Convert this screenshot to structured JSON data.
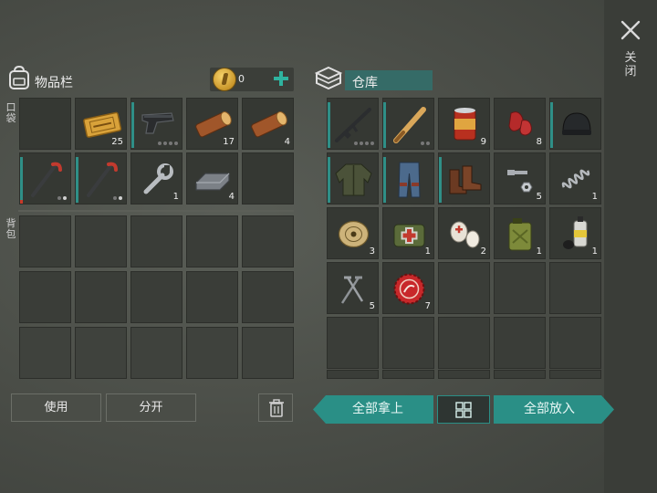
{
  "close": {
    "label": "关闭"
  },
  "inventory": {
    "title": "物品栏",
    "coins": "0",
    "pocket_label": "口袋",
    "backpack_label": "背包",
    "pocket_slots": [
      {
        "item": "",
        "qty": ""
      },
      {
        "item": "coupon",
        "qty": "25"
      },
      {
        "item": "pistol",
        "qty": ""
      },
      {
        "item": "log",
        "qty": "17"
      },
      {
        "item": "log",
        "qty": "4"
      },
      {
        "item": "crowbar",
        "qty": ""
      },
      {
        "item": "crowbar",
        "qty": ""
      },
      {
        "item": "wrench",
        "qty": "1"
      },
      {
        "item": "steel-bar",
        "qty": "4"
      },
      {
        "item": "",
        "qty": ""
      }
    ],
    "buttons": {
      "use": "使用",
      "split": "分开"
    }
  },
  "storage": {
    "title": "仓库",
    "slots": [
      {
        "item": "rifle",
        "qty": ""
      },
      {
        "item": "baseball-bat",
        "qty": ""
      },
      {
        "item": "canned-food",
        "qty": "9"
      },
      {
        "item": "raw-meat",
        "qty": "8"
      },
      {
        "item": "beanie",
        "qty": ""
      },
      {
        "item": "jacket",
        "qty": ""
      },
      {
        "item": "jeans",
        "qty": ""
      },
      {
        "item": "boots",
        "qty": ""
      },
      {
        "item": "nuts-bolts",
        "qty": "5"
      },
      {
        "item": "spring",
        "qty": "1"
      },
      {
        "item": "rope-spool",
        "qty": "3"
      },
      {
        "item": "first-aid-bag",
        "qty": "1"
      },
      {
        "item": "bandage",
        "qty": "2"
      },
      {
        "item": "jerrycan",
        "qty": "1"
      },
      {
        "item": "spray-can",
        "qty": "1"
      },
      {
        "item": "nails",
        "qty": "5"
      },
      {
        "item": "bottle-cap",
        "qty": "7"
      }
    ],
    "buttons": {
      "take_all": "全部拿上",
      "put_all": "全部放入"
    }
  },
  "colors": {
    "accent": "#2fb39f",
    "teal_button": "#2a8f86",
    "background": "#4a4d47"
  },
  "icons": [
    "backpack-icon",
    "coin-icon",
    "plus-icon",
    "storage-box-icon",
    "close-icon",
    "trash-icon",
    "grid-sort-icon"
  ]
}
